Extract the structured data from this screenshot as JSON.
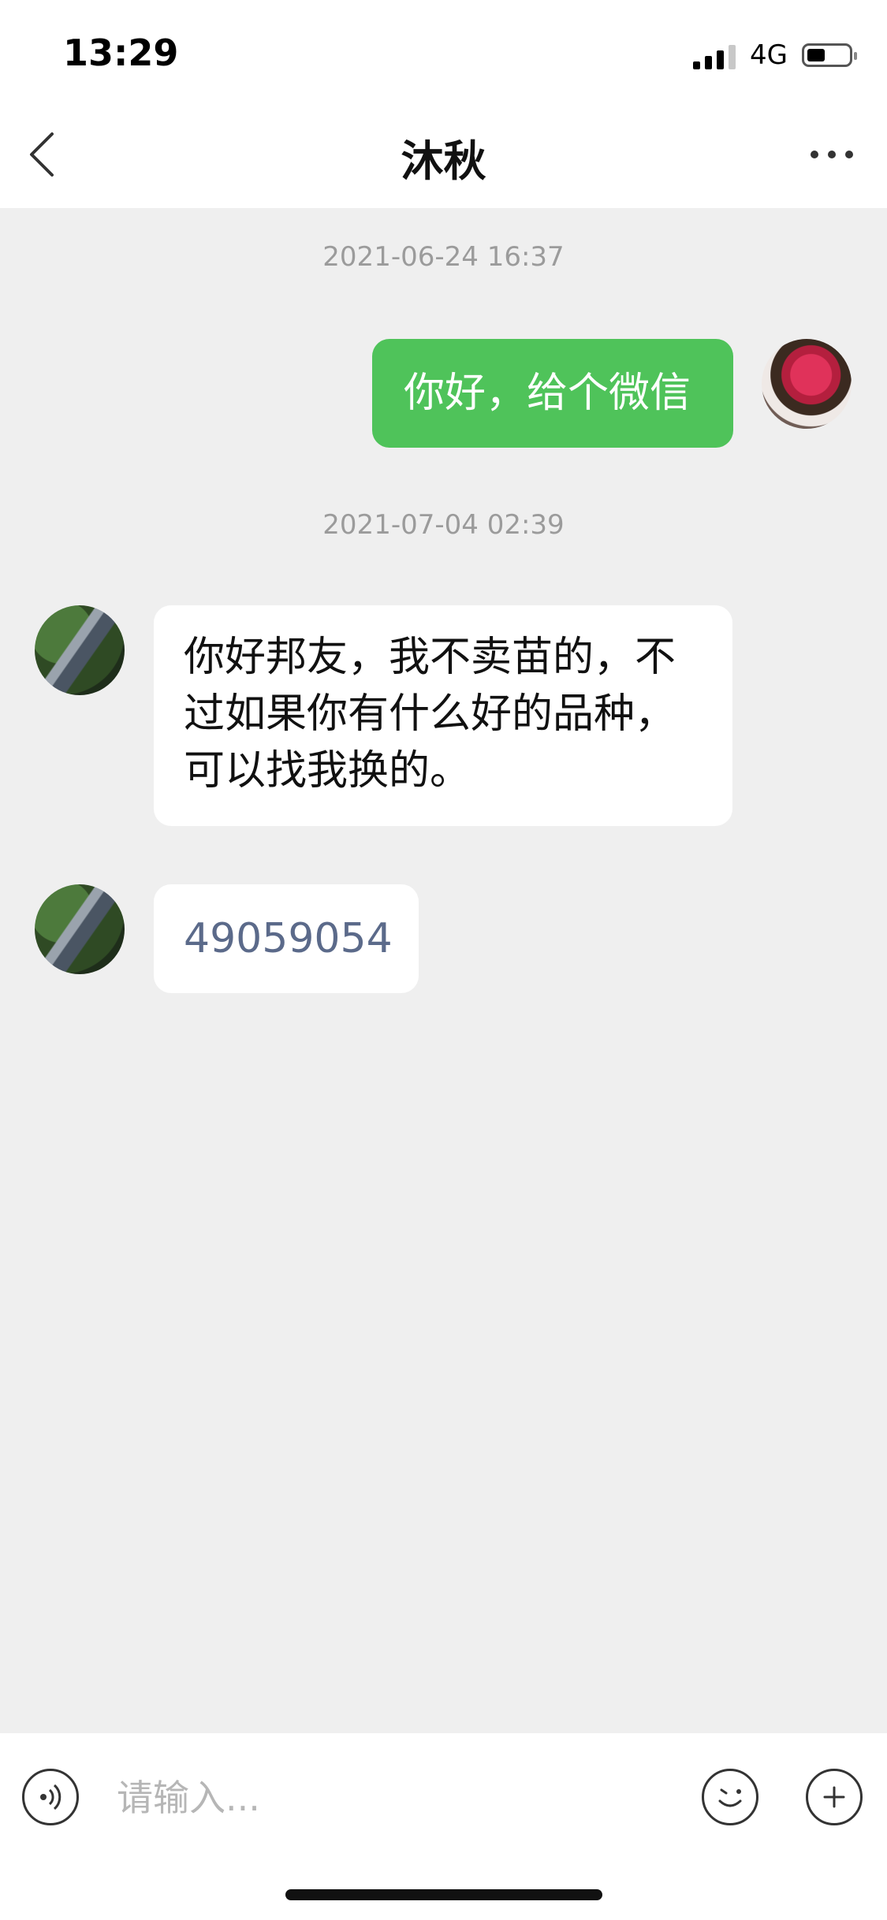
{
  "status_bar": {
    "time": "13:29",
    "network": "4G",
    "icons": [
      "signal-bars-icon",
      "battery-icon"
    ]
  },
  "nav": {
    "title": "沐秋",
    "back_icon": "chevron-left-icon",
    "more_icon": "more-dots-icon"
  },
  "messages": [
    {
      "type": "timestamp",
      "text": "2021-06-24 16:37"
    },
    {
      "type": "message",
      "sender": "me",
      "text": "你好，给个微信"
    },
    {
      "type": "timestamp",
      "text": "2021-07-04 02:39"
    },
    {
      "type": "message",
      "sender": "other",
      "lines": [
        "你好邦友，我不卖苗的，不",
        "过如果你有什么好的品种，",
        "可以找我换的。"
      ]
    },
    {
      "type": "message",
      "sender": "other",
      "text": "49059054"
    }
  ],
  "input_bar": {
    "placeholder": "请输入...",
    "voice_icon": "voice-icon",
    "emoji_icon": "emoji-icon",
    "plus_icon": "plus-icon"
  },
  "colors": {
    "me_bubble": "#4fc35a",
    "chat_background": "#efefef",
    "link_text": "#5b6a8a"
  }
}
